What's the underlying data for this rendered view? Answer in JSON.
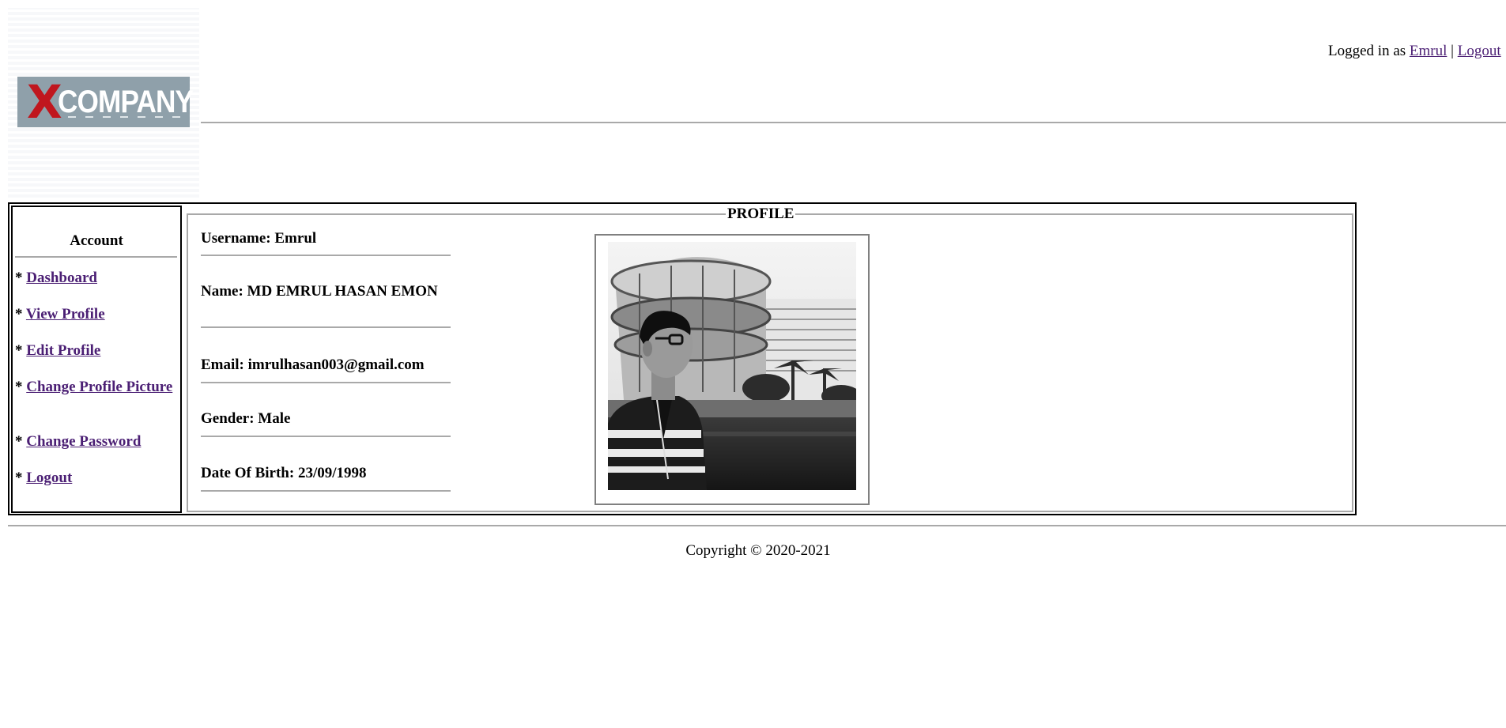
{
  "header": {
    "logo_text_x": "X",
    "logo_text_company": "COMPANY",
    "login_prefix": "Logged in as",
    "username_link": "Emrul",
    "separator": "|",
    "logout_link": "Logout"
  },
  "sidebar": {
    "title": "Account",
    "items": [
      {
        "bullet": "*",
        "label": "Dashboard"
      },
      {
        "bullet": "*",
        "label": "View Profile"
      },
      {
        "bullet": "*",
        "label": "Edit Profile"
      },
      {
        "bullet": "*",
        "label": "Change Profile Picture"
      },
      {
        "bullet": "*",
        "label": "Change Password"
      },
      {
        "bullet": "*",
        "label": "Logout"
      }
    ]
  },
  "profile": {
    "legend": "PROFILE",
    "username": "Username: Emrul",
    "name": "Name: MD EMRUL HASAN EMON",
    "email": "Email: imrulhasan003@gmail.com",
    "gender": "Gender: Male",
    "dob": "Date Of Birth: 23/09/1998"
  },
  "footer": {
    "copyright": "Copyright © 2020-2021"
  },
  "colors": {
    "link": "#4b1f74",
    "logo_bg": "#8fa0aa",
    "logo_x": "#c0161e",
    "rule": "#a9a9a9"
  }
}
